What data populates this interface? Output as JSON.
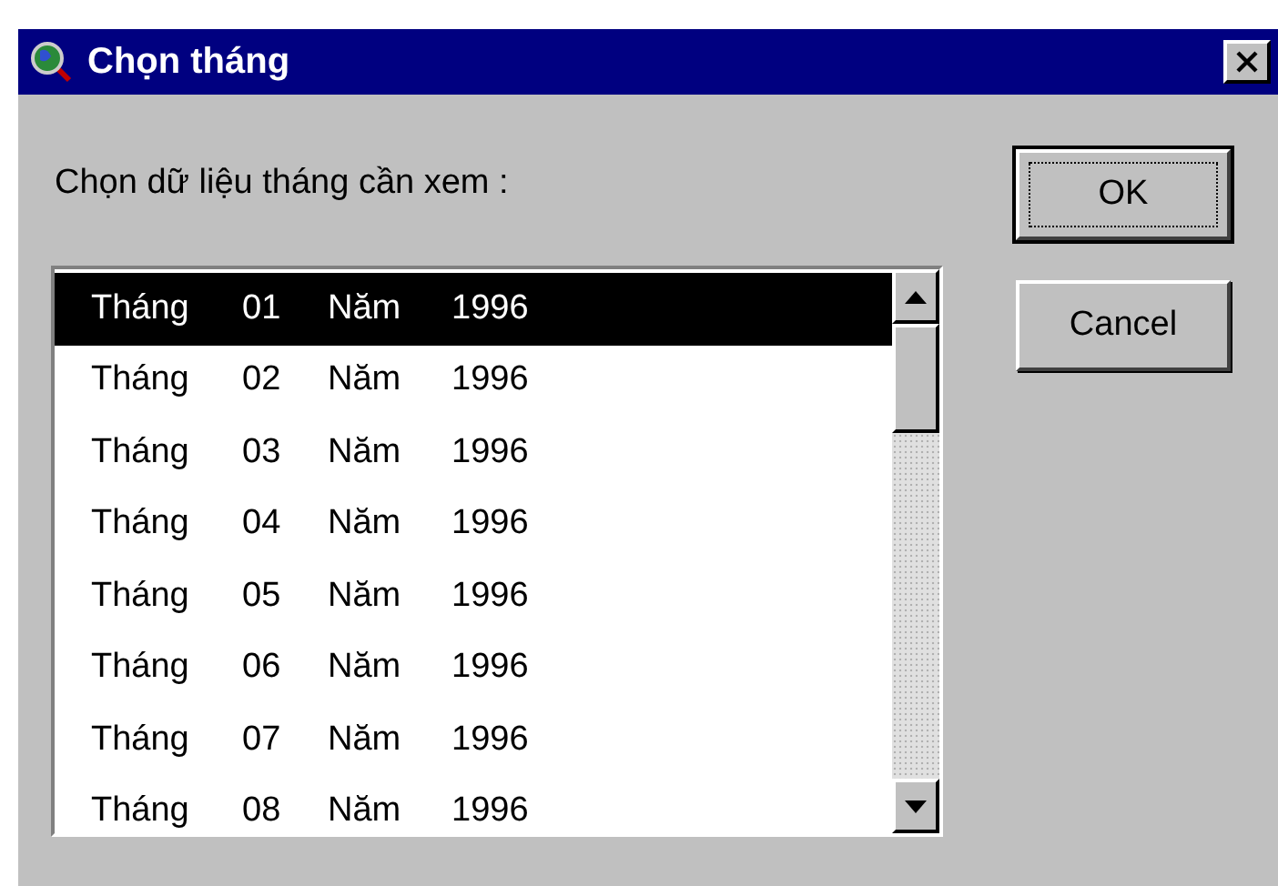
{
  "window": {
    "title": "Chọn tháng"
  },
  "prompt": "Chọn dữ liệu tháng cần xem :",
  "months": [
    {
      "month_label": "Tháng",
      "month": "01",
      "year_label": "Năm",
      "year": "1996",
      "selected": true
    },
    {
      "month_label": "Tháng",
      "month": "02",
      "year_label": "Năm",
      "year": "1996",
      "selected": false
    },
    {
      "month_label": "Tháng",
      "month": "03",
      "year_label": "Năm",
      "year": "1996",
      "selected": false
    },
    {
      "month_label": "Tháng",
      "month": "04",
      "year_label": "Năm",
      "year": "1996",
      "selected": false
    },
    {
      "month_label": "Tháng",
      "month": "05",
      "year_label": "Năm",
      "year": "1996",
      "selected": false
    },
    {
      "month_label": "Tháng",
      "month": "06",
      "year_label": "Năm",
      "year": "1996",
      "selected": false
    },
    {
      "month_label": "Tháng",
      "month": "07",
      "year_label": "Năm",
      "year": "1996",
      "selected": false
    },
    {
      "month_label": "Tháng",
      "month": "08",
      "year_label": "Năm",
      "year": "1996",
      "selected": false
    }
  ],
  "buttons": [
    {
      "label": "OK",
      "default": true
    },
    {
      "label": "Cancel",
      "default": false
    }
  ]
}
